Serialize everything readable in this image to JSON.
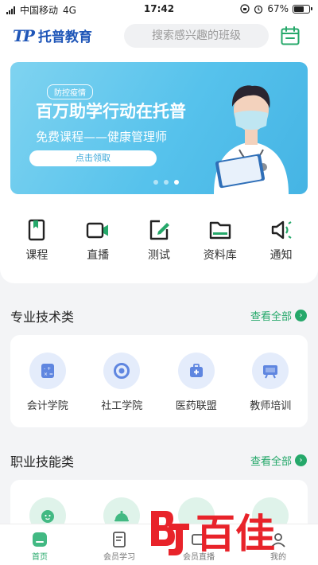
{
  "status": {
    "carrier": "中国移动",
    "network": "4G",
    "time": "17:42",
    "battery": "67%",
    "battery_level": 0.67
  },
  "header": {
    "logo_mark": "TP",
    "logo_text": "托普教育",
    "search_placeholder": "搜索感兴趣的班级",
    "calendar_icon": "calendar-icon"
  },
  "banner": {
    "tag": "防控疫情",
    "headline": "百万助学行动在托普",
    "sub": "免费课程——健康管理师",
    "cta": "点击领取",
    "dots": 3,
    "active_dot": 2
  },
  "quick_nav": [
    {
      "label": "课程",
      "icon": "book-icon"
    },
    {
      "label": "直播",
      "icon": "video-camera-icon"
    },
    {
      "label": "测试",
      "icon": "edit-icon"
    },
    {
      "label": "资料库",
      "icon": "folder-icon"
    },
    {
      "label": "通知",
      "icon": "speaker-icon"
    }
  ],
  "section1": {
    "title": "专业技术类",
    "see_all": "查看全部",
    "items": [
      {
        "label": "会计学院",
        "icon": "calculator-icon"
      },
      {
        "label": "社工学院",
        "icon": "target-icon"
      },
      {
        "label": "医药联盟",
        "icon": "medical-kit-icon"
      },
      {
        "label": "教师培训",
        "icon": "blackboard-icon"
      }
    ]
  },
  "section2": {
    "title": "职业技能类",
    "see_all": "查看全部",
    "items": [
      {
        "label": "",
        "icon": "baby-face-icon"
      },
      {
        "label": "",
        "icon": "food-cloche-icon"
      },
      {
        "label": "",
        "icon": "unknown-icon"
      },
      {
        "label": "",
        "icon": "unknown-icon"
      }
    ]
  },
  "tabbar": [
    {
      "label": "首页",
      "icon": "home-icon",
      "active": true
    },
    {
      "label": "会员学习",
      "icon": "study-icon",
      "active": false
    },
    {
      "label": "会员直播",
      "icon": "live-icon",
      "active": false
    },
    {
      "label": "我的",
      "icon": "profile-icon",
      "active": false
    }
  ],
  "watermark": {
    "text": "百佳"
  },
  "colors": {
    "accent": "#25a86a",
    "brand": "#1f56b8",
    "banner": "#56c2ec",
    "watermark": "#e8232a"
  }
}
